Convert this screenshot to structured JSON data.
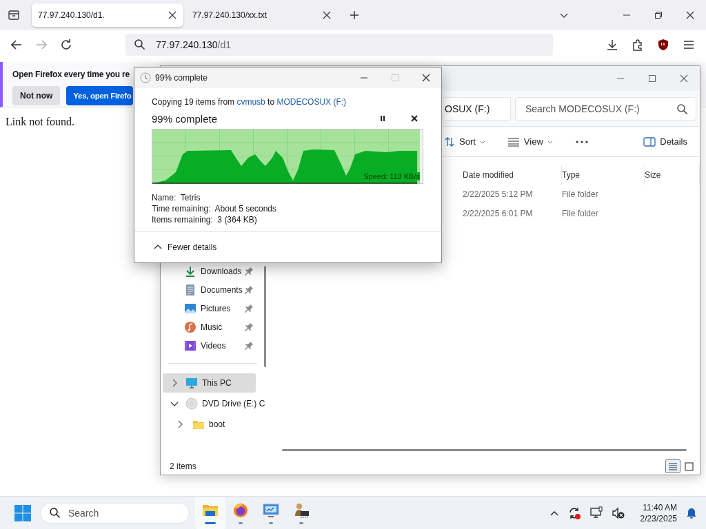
{
  "browser": {
    "tabs": [
      {
        "title": "77.97.240.130/d1.",
        "selected": true
      },
      {
        "title": "77.97.240.130/xx.txt",
        "selected": false
      }
    ],
    "nav_buttons": [
      {
        "kind": "back",
        "disabled": false
      },
      {
        "kind": "forward",
        "disabled": true
      },
      {
        "kind": "reload",
        "disabled": false
      }
    ],
    "address": {
      "host": "77.97.240.130",
      "path": "/d1"
    },
    "notification": {
      "message": "Open Firefox every time you re",
      "buttons": [
        {
          "label": "Not now",
          "primary": false
        },
        {
          "label": "Yes, open Firefo",
          "primary": true
        }
      ]
    },
    "page_text": "Link not found."
  },
  "explorer": {
    "location": "OSUX (F:)",
    "search": {
      "placeholder": "Search MODECOSUX (F:)"
    },
    "commands": [
      {
        "kind": "sort",
        "label": "Sort"
      },
      {
        "kind": "view",
        "label": "View"
      },
      {
        "kind": "more"
      },
      {
        "kind": "details",
        "label": "Details"
      }
    ],
    "columns": [
      "Date modified",
      "Type",
      "Size"
    ],
    "rows": [
      {
        "date_modified": "2/22/2025 5:12 PM",
        "type": "File folder"
      },
      {
        "date_modified": "2/22/2025 6:01 PM",
        "type": "File folder"
      }
    ],
    "quick_access": [
      {
        "label": "Downloads",
        "kind": "downloads",
        "pinned": true,
        "selected": false
      },
      {
        "label": "Documents",
        "kind": "documents",
        "pinned": true,
        "selected": false
      },
      {
        "label": "Pictures",
        "kind": "pictures",
        "pinned": true,
        "selected": false
      },
      {
        "label": "Music",
        "kind": "music",
        "pinned": true,
        "selected": false
      },
      {
        "label": "Videos",
        "kind": "videos",
        "pinned": true,
        "selected": false
      }
    ],
    "tree": [
      {
        "label": "This PC",
        "kind": "pc",
        "selected": true,
        "expanded": false
      },
      {
        "label": "DVD Drive (E:) C",
        "kind": "dvd",
        "selected": false,
        "expanded": true,
        "children": [
          {
            "label": "boot",
            "kind": "folder",
            "selected": false,
            "expanded": false
          }
        ]
      }
    ],
    "status": "2 items",
    "views": [
      {
        "kind": "details",
        "selected": true
      },
      {
        "kind": "tiles",
        "selected": false
      }
    ]
  },
  "copy_dialog": {
    "title": "99% complete",
    "copying": [
      {
        "text": "Copying 19 items from ",
        "link": false
      },
      {
        "text": "cvmusb",
        "link": true
      },
      {
        "text": " to ",
        "link": false
      },
      {
        "text": "MODECOSUX (F:)",
        "link": true
      }
    ],
    "heading": "99% complete",
    "level": 0.99,
    "speed": "Speed: 113 KB/s",
    "details": [
      "Name:  Tetris",
      "Time remaining:  About 5 seconds",
      "Items remaining:  3 (364 KB)"
    ],
    "toggle": "Fewer details"
  },
  "taskbar": {
    "search": {
      "placeholder": "Search"
    },
    "apps": [
      {
        "kind": "explorer",
        "active": true
      },
      {
        "kind": "firefox",
        "active": false
      },
      {
        "kind": "monitor",
        "active": false
      },
      {
        "kind": "person-chip",
        "active": false
      }
    ],
    "time": "11:40 AM",
    "date": "2/23/2025"
  }
}
